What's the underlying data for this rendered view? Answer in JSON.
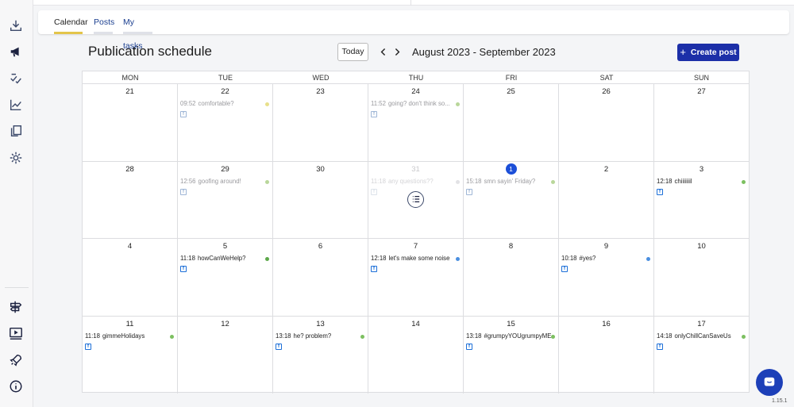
{
  "tabs": [
    {
      "label": "Calendar",
      "active": true,
      "underline_color": "#e3c54a"
    },
    {
      "label": "Posts",
      "active": false,
      "underline_color": "#dfe1e8"
    },
    {
      "label": "My tasks",
      "active": false,
      "underline_color": "#dfe1e8"
    }
  ],
  "header": {
    "title": "Publication schedule",
    "today_label": "Today",
    "date_range": "August 2023 - September 2023",
    "create_label": "Create post"
  },
  "weekdays": [
    "MON",
    "TUE",
    "WED",
    "THU",
    "FRI",
    "SAT",
    "SUN"
  ],
  "weeks": [
    [
      {
        "day": "21"
      },
      {
        "day": "22",
        "post": {
          "time": "09:52",
          "title": "comfortable?",
          "state": "past",
          "dot": "#e8e08a"
        }
      },
      {
        "day": "23"
      },
      {
        "day": "24",
        "post": {
          "time": "11:52",
          "title": "going? don't think so...",
          "state": "past",
          "dot": "#b9d79a"
        }
      },
      {
        "day": "25"
      },
      {
        "day": "26"
      },
      {
        "day": "27"
      }
    ],
    [
      {
        "day": "28"
      },
      {
        "day": "29",
        "post": {
          "time": "12:56",
          "title": "goofing around!",
          "state": "past",
          "dot": "#b9d79a"
        }
      },
      {
        "day": "30"
      },
      {
        "day": "31",
        "faded": true,
        "action": true,
        "post": {
          "time": "11:18",
          "title": "any questions??",
          "state": "ghost",
          "dot": "#e2e2e5"
        }
      },
      {
        "day": "1",
        "current": true,
        "post": {
          "time": "15:18",
          "title": "smn sayin' Friday?",
          "state": "past",
          "dot": "#b9d79a"
        }
      },
      {
        "day": "2"
      },
      {
        "day": "3",
        "post": {
          "time": "12:18",
          "title": "chiiiiiiil",
          "state": "normal",
          "dot": "#7cc060"
        }
      }
    ],
    [
      {
        "day": "4"
      },
      {
        "day": "5",
        "post": {
          "time": "11:18",
          "title": "howCanWeHelp?",
          "state": "normal",
          "dot": "#5da84a"
        }
      },
      {
        "day": "6"
      },
      {
        "day": "7",
        "post": {
          "time": "12:18",
          "title": "let's make some noise",
          "state": "normal",
          "dot": "#4a8fe0"
        }
      },
      {
        "day": "8"
      },
      {
        "day": "9",
        "post": {
          "time": "10:18",
          "title": "#yes?",
          "state": "normal",
          "dot": "#4a8fe0"
        }
      },
      {
        "day": "10"
      }
    ],
    [
      {
        "day": "11",
        "post": {
          "time": "11:18",
          "title": "gimmeHolidays",
          "state": "normal",
          "dot": "#7cc060"
        }
      },
      {
        "day": "12"
      },
      {
        "day": "13",
        "post": {
          "time": "13:18",
          "title": "he? problem?",
          "state": "normal",
          "dot": "#7cc060"
        }
      },
      {
        "day": "14"
      },
      {
        "day": "15",
        "post": {
          "time": "13:18",
          "title": "#grumpyYOUgrumpyME",
          "state": "normal",
          "dot": "#7cc060"
        }
      },
      {
        "day": "16"
      },
      {
        "day": "17",
        "post": {
          "time": "14:18",
          "title": "onlyChillCanSaveUs",
          "state": "normal",
          "dot": "#7cc060"
        }
      }
    ]
  ],
  "sidebar": {
    "top_icons": [
      "download-icon",
      "megaphone-icon",
      "checklist-icon",
      "analytics-icon",
      "copy-icon",
      "settings-icon"
    ],
    "bottom_icons": [
      "signpost-icon",
      "video-tutorial-icon",
      "rocket-icon",
      "info-icon"
    ]
  },
  "version": "1.15.1",
  "colors": {
    "primary": "#1c2fa8",
    "today": "#1c4fd8",
    "facebook": "#1c6fd8"
  }
}
